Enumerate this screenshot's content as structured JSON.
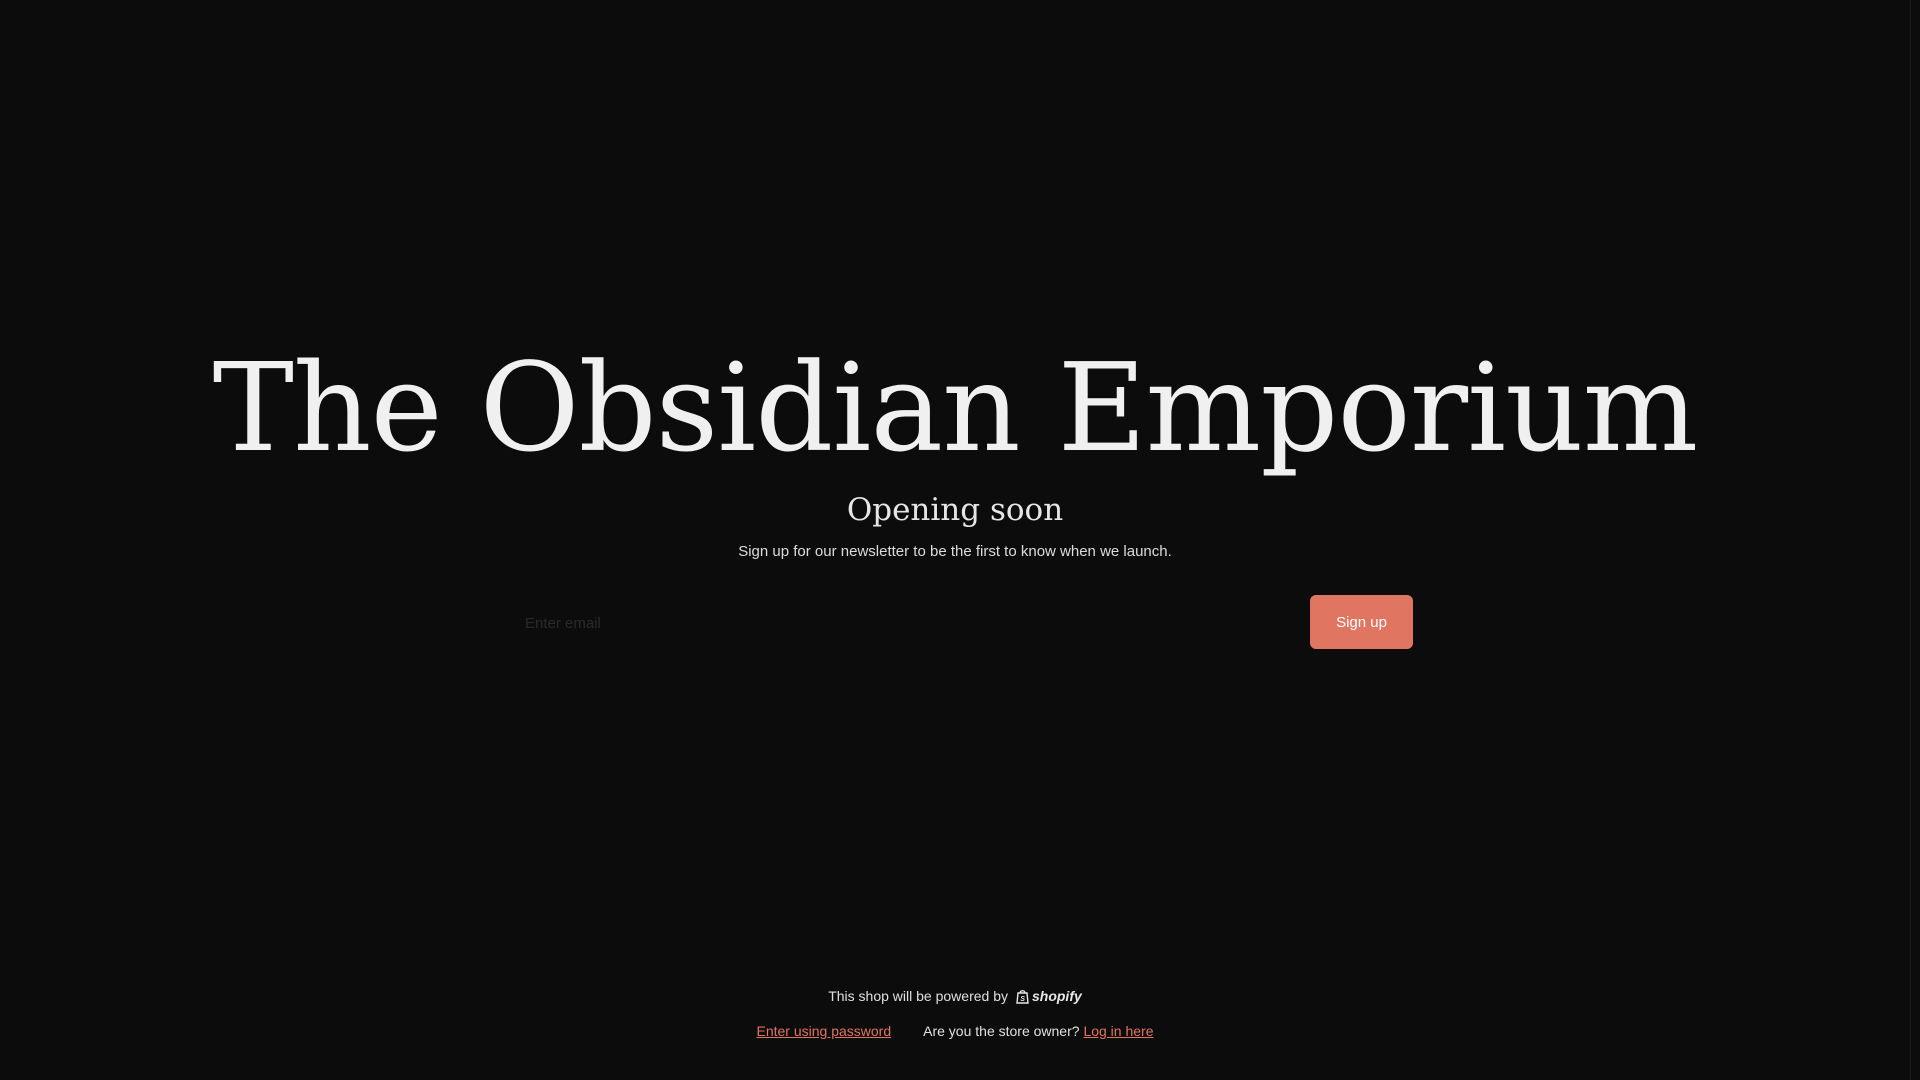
{
  "store": {
    "title": "The Obsidian Emporium",
    "subtitle": "Opening soon",
    "tagline": "Sign up for our newsletter to be the first to know when we launch."
  },
  "signup": {
    "email_placeholder": "Enter email",
    "email_value": "",
    "button_label": "Sign up"
  },
  "footer": {
    "powered_by_text": "This shop will be powered by",
    "shopify_logo_text": "shopify",
    "enter_password_link": "Enter using password",
    "owner_question": "Are you the store owner?",
    "login_link": "Log in here"
  },
  "colors": {
    "background": "#0c0c0c",
    "accent": "#e07561",
    "text": "#f0f0f0"
  }
}
